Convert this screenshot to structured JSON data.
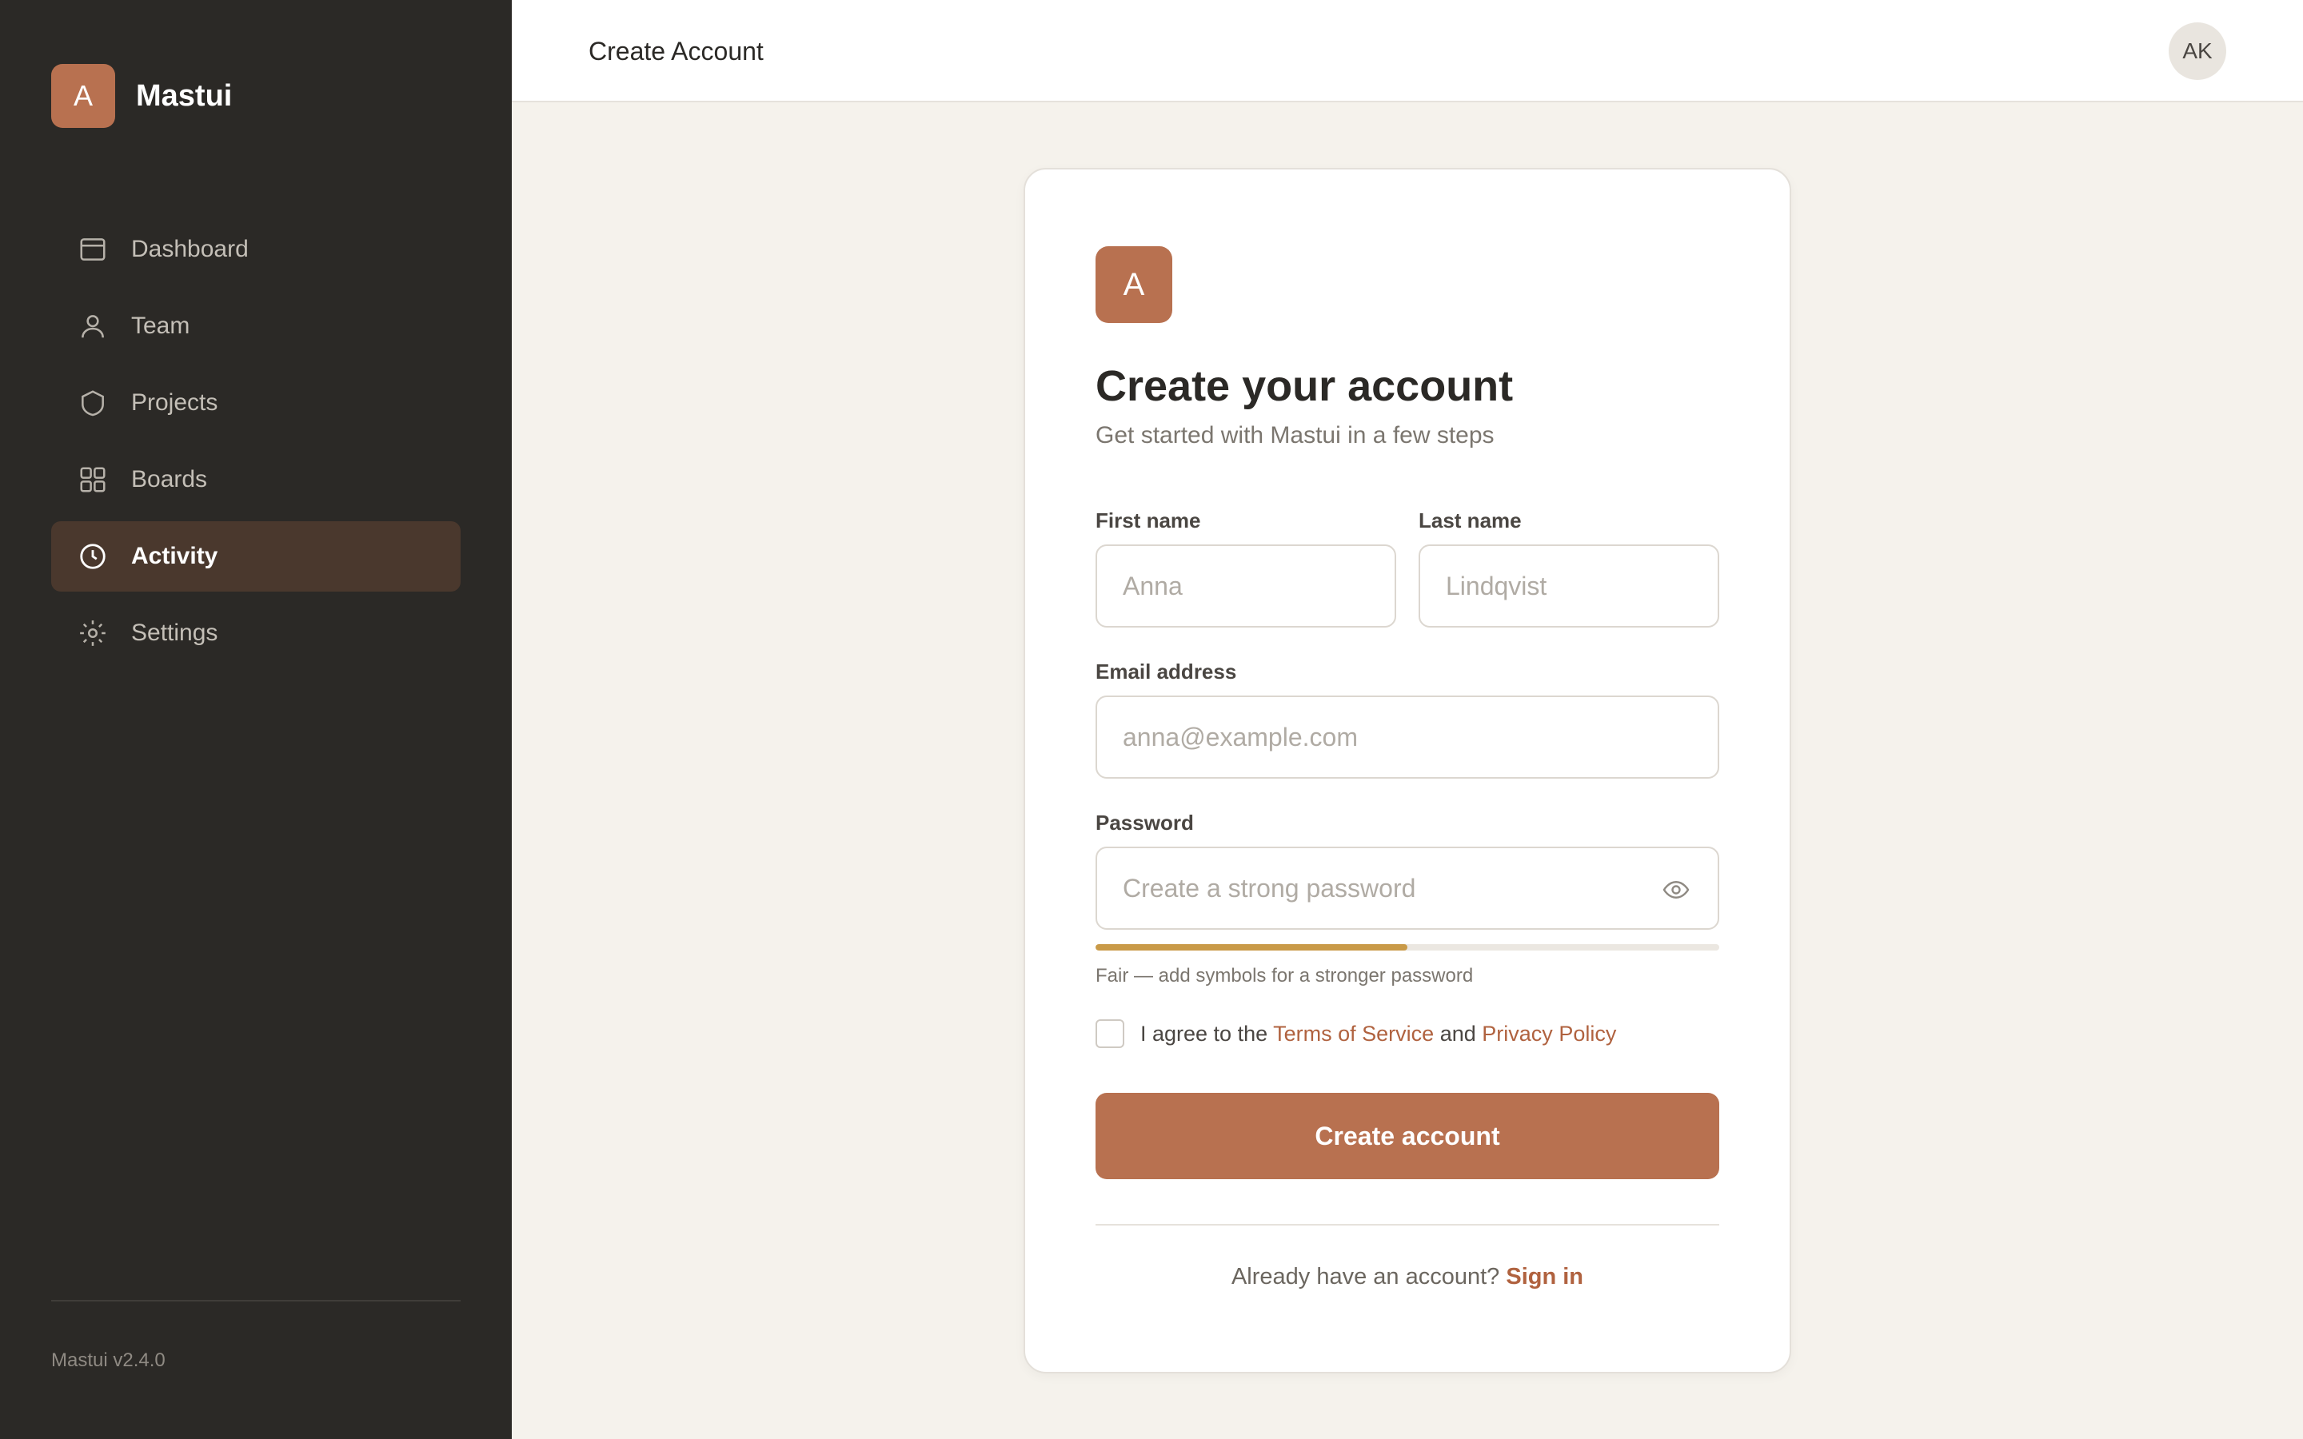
{
  "brand": {
    "logo_letter": "A",
    "name": "Mastui"
  },
  "sidebar": {
    "items": [
      {
        "label": "Dashboard",
        "icon": "dashboard-icon",
        "active": false
      },
      {
        "label": "Team",
        "icon": "user-icon",
        "active": false
      },
      {
        "label": "Projects",
        "icon": "shield-icon",
        "active": false
      },
      {
        "label": "Boards",
        "icon": "grid-icon",
        "active": false
      },
      {
        "label": "Activity",
        "icon": "clock-icon",
        "active": true
      },
      {
        "label": "Settings",
        "icon": "gear-icon",
        "active": false
      }
    ],
    "version": "Mastui v2.4.0"
  },
  "header": {
    "title": "Create Account",
    "avatar_initials": "AK"
  },
  "form": {
    "logo_letter": "A",
    "title": "Create your account",
    "subtitle": "Get started with Mastui in a few steps",
    "first_name": {
      "label": "First name",
      "placeholder": "Anna",
      "value": ""
    },
    "last_name": {
      "label": "Last name",
      "placeholder": "Lindqvist",
      "value": ""
    },
    "email": {
      "label": "Email address",
      "placeholder": "anna@example.com",
      "value": ""
    },
    "password": {
      "label": "Password",
      "placeholder": "Create a strong password",
      "value": ""
    },
    "strength": {
      "level": 0.5,
      "text": "Fair — add symbols for a stronger password"
    },
    "agree": {
      "checked": false,
      "prefix": "I agree to the",
      "terms": "Terms of Service",
      "and": "and",
      "privacy": "Privacy Policy"
    },
    "submit_label": "Create account",
    "signin_prompt": "Already have an account?",
    "signin_link": "Sign in"
  },
  "colors": {
    "sidebar_bg": "#2b2926",
    "accent": "#b87150",
    "active_nav_bg": "#4a382d",
    "page_bg": "#f5f2ec",
    "strength_fair": "#c99a48",
    "link": "#b0623f"
  }
}
